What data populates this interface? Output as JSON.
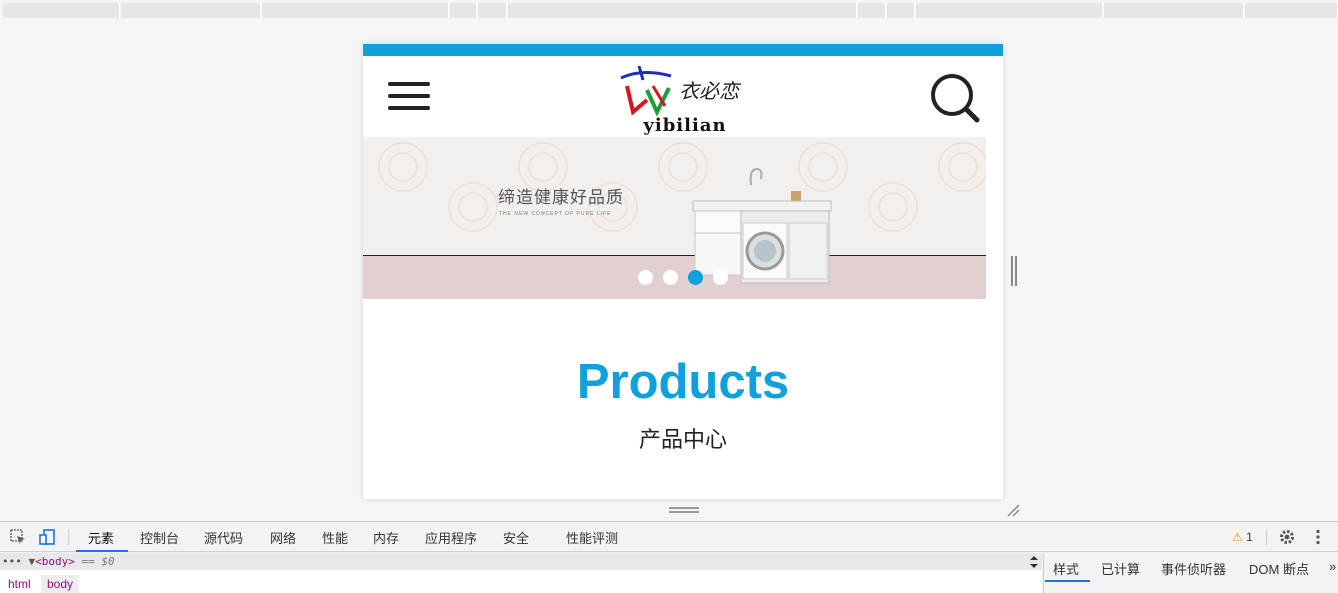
{
  "page": {
    "logo_text": "yibilian",
    "logo_cn": "衣必恋",
    "banner_title": "缔造健康好品质",
    "banner_subtitle": "THE NEW CONCEPT OF PURE LIFE",
    "slide_count": 4,
    "active_slide": 3,
    "products_title": "Products",
    "products_subtitle": "产品中心",
    "accent_color": "#10a1dc"
  },
  "devtools": {
    "tabs": [
      "元素",
      "控制台",
      "源代码",
      "网络",
      "性能",
      "内存",
      "应用程序",
      "安全",
      "性能评测"
    ],
    "active_tab": "元素",
    "warning_count": "1",
    "dom_line_tag": "<body>",
    "dom_line_suffix": "== $0",
    "breadcrumbs": [
      "html",
      "body"
    ],
    "side_tabs": [
      "样式",
      "已计算",
      "事件侦听器",
      "DOM 断点"
    ],
    "side_more": "»"
  }
}
